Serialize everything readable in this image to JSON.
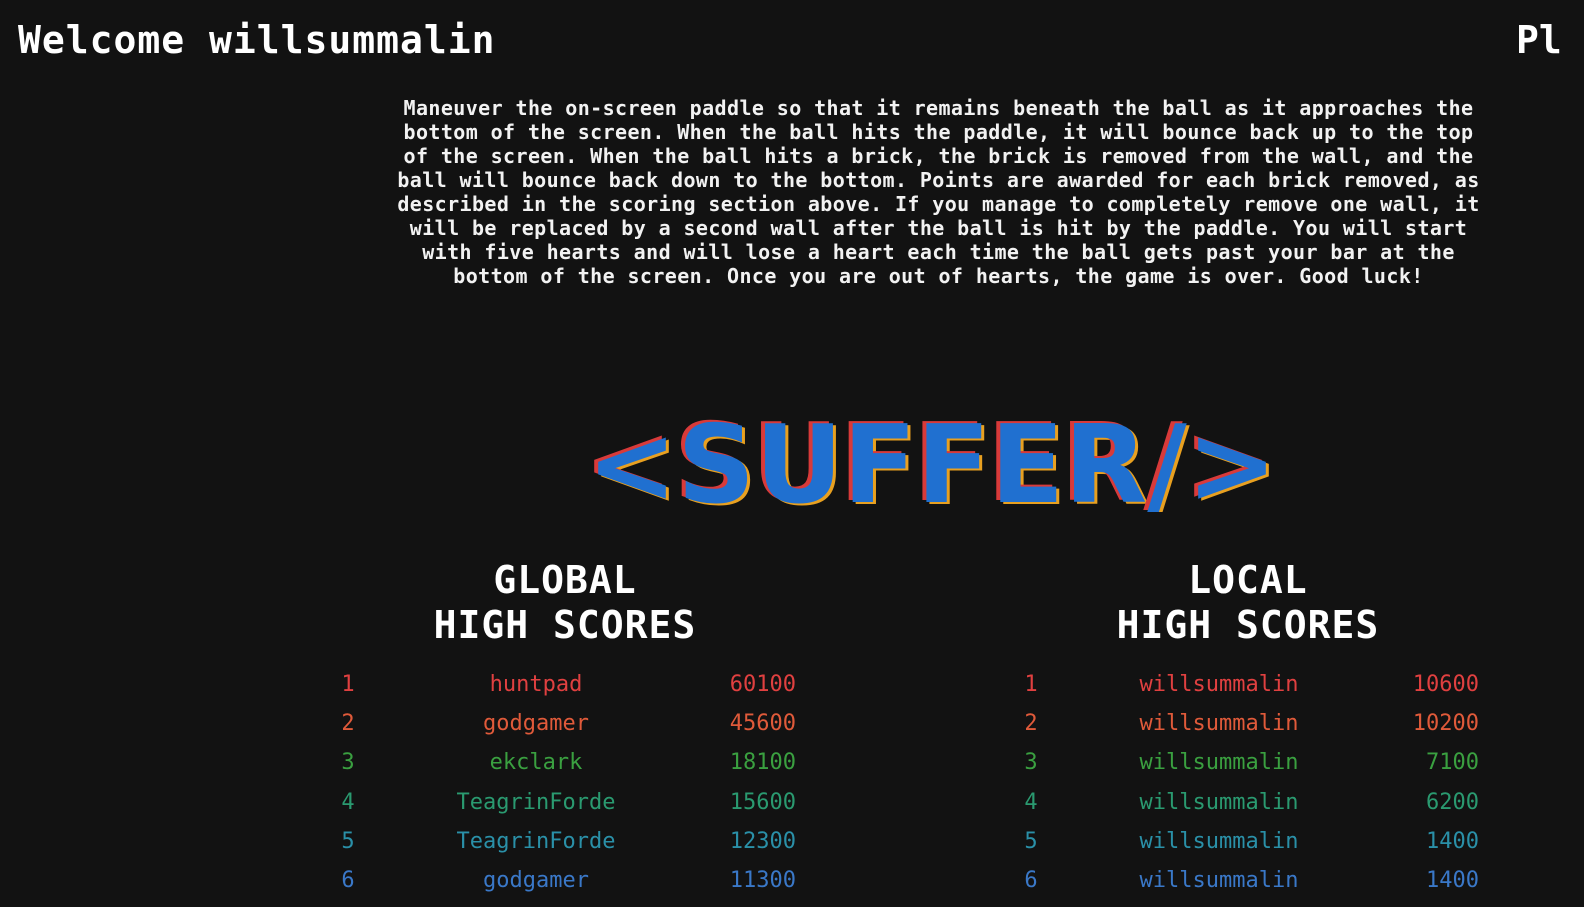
{
  "header": {
    "welcome": "Welcome willsummalin",
    "play_label": "Pl"
  },
  "instructions": "Maneuver the on-screen paddle so that it remains beneath the ball as it approaches the bottom of the screen. When the ball hits the paddle, it will bounce back up to the top of the screen. When the ball hits a brick, the brick is removed from the wall, and the ball will bounce back down to the bottom. Points are awarded for each brick removed, as described in the scoring section above. If you manage to completely remove one wall, it will be replaced by a second wall after the ball is hit by the paddle. You will start with five hearts and will lose a heart each time the ball gets past your bar at the bottom of the screen. Once you are out of hearts, the game is over. Good luck!",
  "logo": {
    "text": "<SUFFER/>",
    "colors": {
      "fill": "#2070d0",
      "shadow_red": "#d83a3a",
      "shadow_orange": "#e8a020"
    }
  },
  "global": {
    "title_line1": "GLOBAL",
    "title_line2": "HIGH SCORES",
    "rows": [
      {
        "rank": "1",
        "name": "huntpad",
        "score": "60100"
      },
      {
        "rank": "2",
        "name": "godgamer",
        "score": "45600"
      },
      {
        "rank": "3",
        "name": "ekclark",
        "score": "18100"
      },
      {
        "rank": "4",
        "name": "TeagrinForde",
        "score": "15600"
      },
      {
        "rank": "5",
        "name": "TeagrinForde",
        "score": "12300"
      },
      {
        "rank": "6",
        "name": "godgamer",
        "score": "11300"
      }
    ]
  },
  "local": {
    "title_line1": "LOCAL",
    "title_line2": "HIGH SCORES",
    "rows": [
      {
        "rank": "1",
        "name": "willsummalin",
        "score": "10600"
      },
      {
        "rank": "2",
        "name": "willsummalin",
        "score": "10200"
      },
      {
        "rank": "3",
        "name": "willsummalin",
        "score": "7100"
      },
      {
        "rank": "4",
        "name": "willsummalin",
        "score": "6200"
      },
      {
        "rank": "5",
        "name": "willsummalin",
        "score": "1400"
      },
      {
        "rank": "6",
        "name": "willsummalin",
        "score": "1400"
      }
    ]
  },
  "row_colors": [
    "#e04040",
    "#e05a3a",
    "#3aa040",
    "#2a9a70",
    "#2a90a8",
    "#3a78c8"
  ]
}
